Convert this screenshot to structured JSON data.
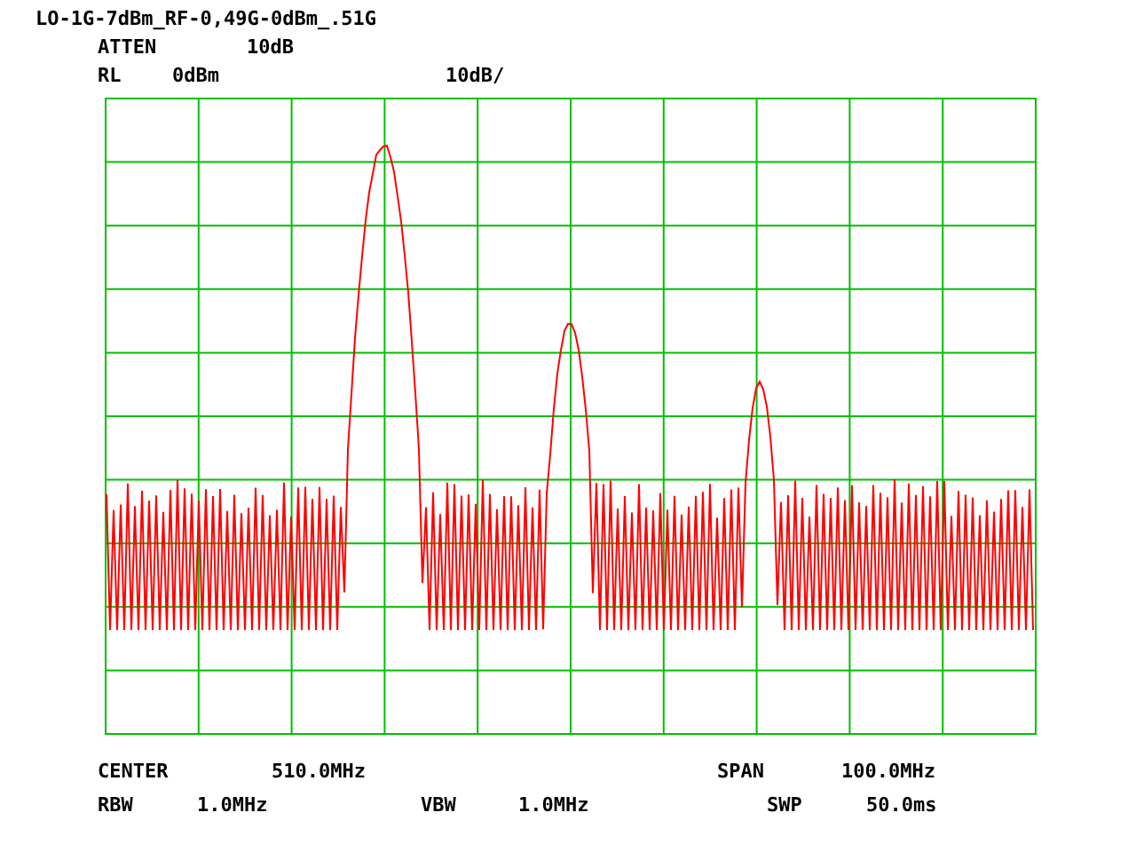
{
  "title": "LO-1G-7dBm_RF-0,49G-0dBm_.51G",
  "attenuation": {
    "label": "ATTEN",
    "value": "10dB"
  },
  "reference_level": {
    "label": "RL",
    "value": "0dBm"
  },
  "scale": "10dB/",
  "center": {
    "label": "CENTER",
    "value": "510.0MHz"
  },
  "span": {
    "label": "SPAN",
    "value": "100.0MHz"
  },
  "rbw": {
    "label": "RBW",
    "value": "1.0MHz"
  },
  "vbw": {
    "label": "VBW",
    "value": "1.0MHz"
  },
  "sweep": {
    "label": "SWP",
    "value": "50.0ms"
  }
}
